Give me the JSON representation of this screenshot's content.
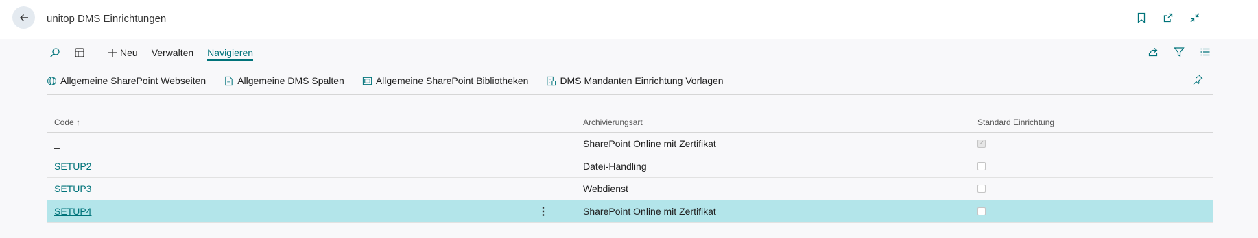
{
  "header": {
    "title": "unitop DMS Einrichtungen",
    "icons": [
      "bookmark-icon",
      "open-new-window-icon",
      "collapse-icon"
    ]
  },
  "actionbar": {
    "new_label": "Neu",
    "manage_label": "Verwalten",
    "navigate_label": "Navigieren",
    "right_icons": [
      "share-icon",
      "filter-icon",
      "list-view-icon"
    ]
  },
  "navigate_actions": [
    {
      "label": "Allgemeine SharePoint Webseiten",
      "icon": "globe-icon"
    },
    {
      "label": "Allgemeine DMS Spalten",
      "icon": "document-icon"
    },
    {
      "label": "Allgemeine SharePoint Bibliotheken",
      "icon": "library-icon"
    },
    {
      "label": "DMS Mandanten Einrichtung Vorlagen",
      "icon": "template-icon"
    }
  ],
  "table": {
    "columns": {
      "code": "Code ↑",
      "archivierungsart": "Archivierungsart",
      "standard": "Standard Einrichtung"
    },
    "rows": [
      {
        "code": "_",
        "archivierungsart": "SharePoint Online mit Zertifikat",
        "standard": true
      },
      {
        "code": "SETUP2",
        "archivierungsart": "Datei-Handling",
        "standard": false
      },
      {
        "code": "SETUP3",
        "archivierungsart": "Webdienst",
        "standard": false
      },
      {
        "code": "SETUP4",
        "archivierungsart": "SharePoint Online mit Zertifikat",
        "standard": false,
        "selected": true
      }
    ],
    "row_menu": "⋮"
  },
  "colors": {
    "accent": "#00737a",
    "selected_row": "#b3e5ea",
    "background": "#f8f8fa"
  }
}
